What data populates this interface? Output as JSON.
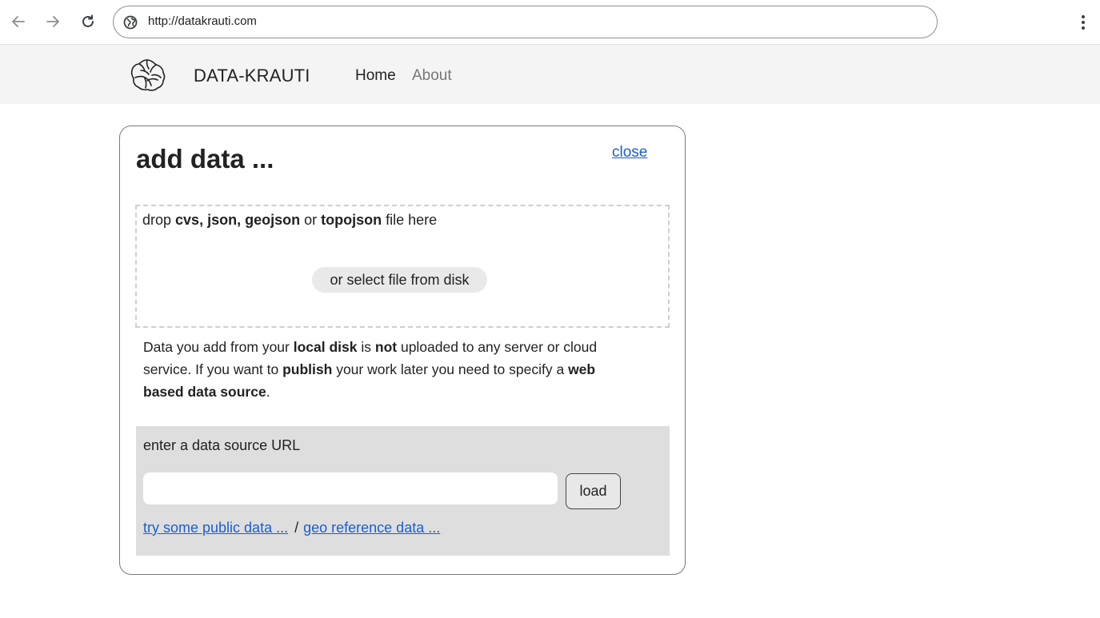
{
  "browser": {
    "url": "http://datakrauti.com",
    "icons": {
      "back": "arrow-left-icon",
      "forward": "arrow-right-icon",
      "reload": "reload-icon",
      "site": "globe-icon",
      "menu": "kebab-menu-icon"
    }
  },
  "navbar": {
    "brand": "DATA-KRAUTI",
    "logo_icon": "cabbage-logo-icon",
    "links": [
      {
        "label": "Home",
        "active": true
      },
      {
        "label": "About",
        "active": false
      }
    ]
  },
  "panel": {
    "title": "add data ...",
    "close_label": "close",
    "dropzone": {
      "prefix": "drop ",
      "formats_bold": "cvs, json, geojson",
      "or_text": " or ",
      "last_format_bold": "topojson",
      "suffix": " file here",
      "select_button_label": "or select file from disk"
    },
    "info": {
      "part1": "Data you add from your ",
      "bold1": "local disk",
      "part2": " is ",
      "bold2": "not",
      "part3": " uploaded to any server or cloud service. If you want to ",
      "bold3": "publish",
      "part4": " your work later you need to specify a ",
      "bold4": "web based data source",
      "part5": "."
    },
    "url_section": {
      "label": "enter a data source URL",
      "input_value": "",
      "input_placeholder": "",
      "load_label": "load",
      "public_data_link": "try some public data ...",
      "separator": "/",
      "geo_reference_link": "geo reference data ..."
    }
  },
  "colors": {
    "link": "#1a5fd0",
    "navbar_bg": "#f4f4f5",
    "url_section_bg": "#dedede",
    "nav_inactive": "#777777"
  }
}
